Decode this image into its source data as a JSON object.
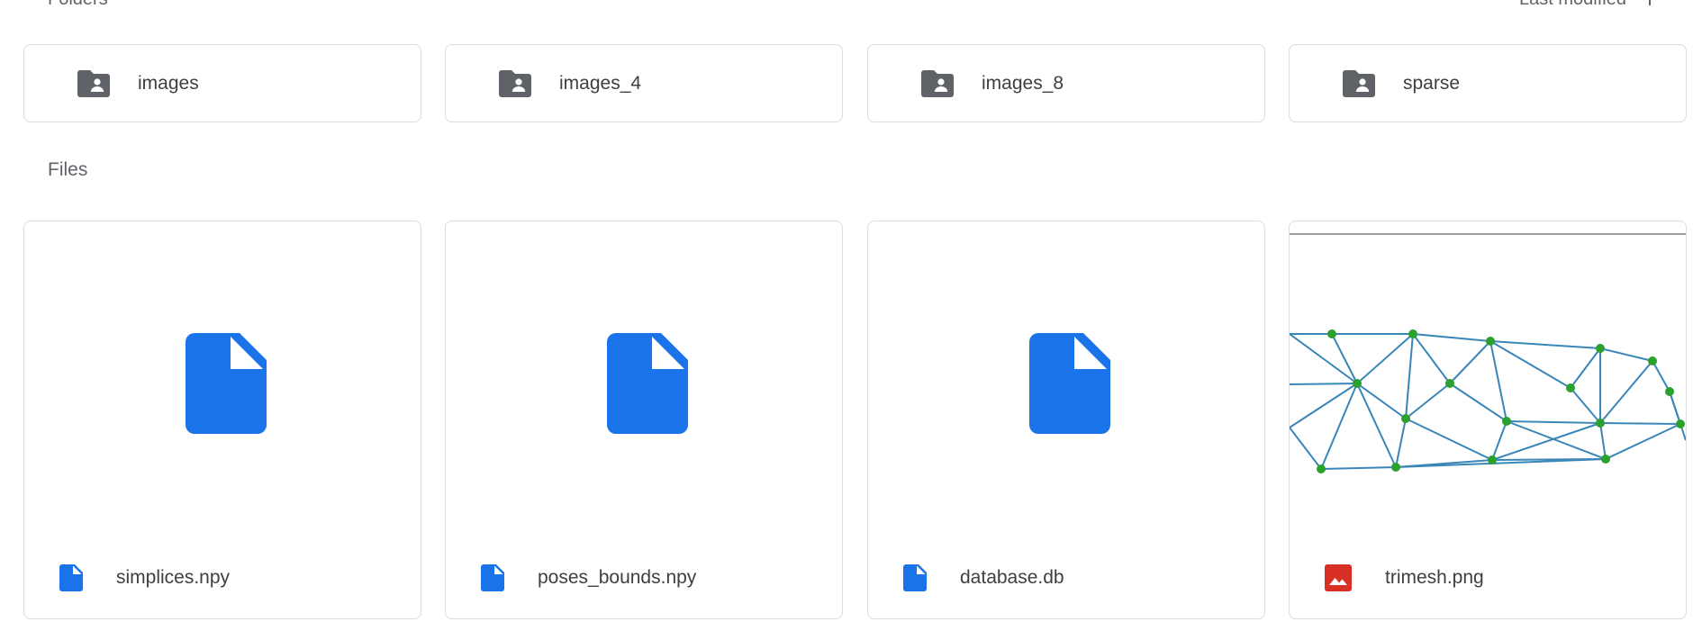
{
  "folders_header": {
    "title": "Folders",
    "sort_label": "Last modified"
  },
  "folders": [
    {
      "name": "images"
    },
    {
      "name": "images_4"
    },
    {
      "name": "images_8"
    },
    {
      "name": "sparse"
    }
  ],
  "files_header": {
    "title": "Files"
  },
  "files": [
    {
      "name": "simplices.npy",
      "icon": "document-icon"
    },
    {
      "name": "poses_bounds.npy",
      "icon": "document-icon"
    },
    {
      "name": "database.db",
      "icon": "document-icon"
    },
    {
      "name": "trimesh.png",
      "icon": "image-icon"
    }
  ],
  "colors": {
    "folder_icon": "#5f6368",
    "doc_icon": "#1a73e8",
    "image_icon": "#d93025",
    "mesh_edge": "#3a86b8",
    "mesh_node": "#2ca02c"
  }
}
